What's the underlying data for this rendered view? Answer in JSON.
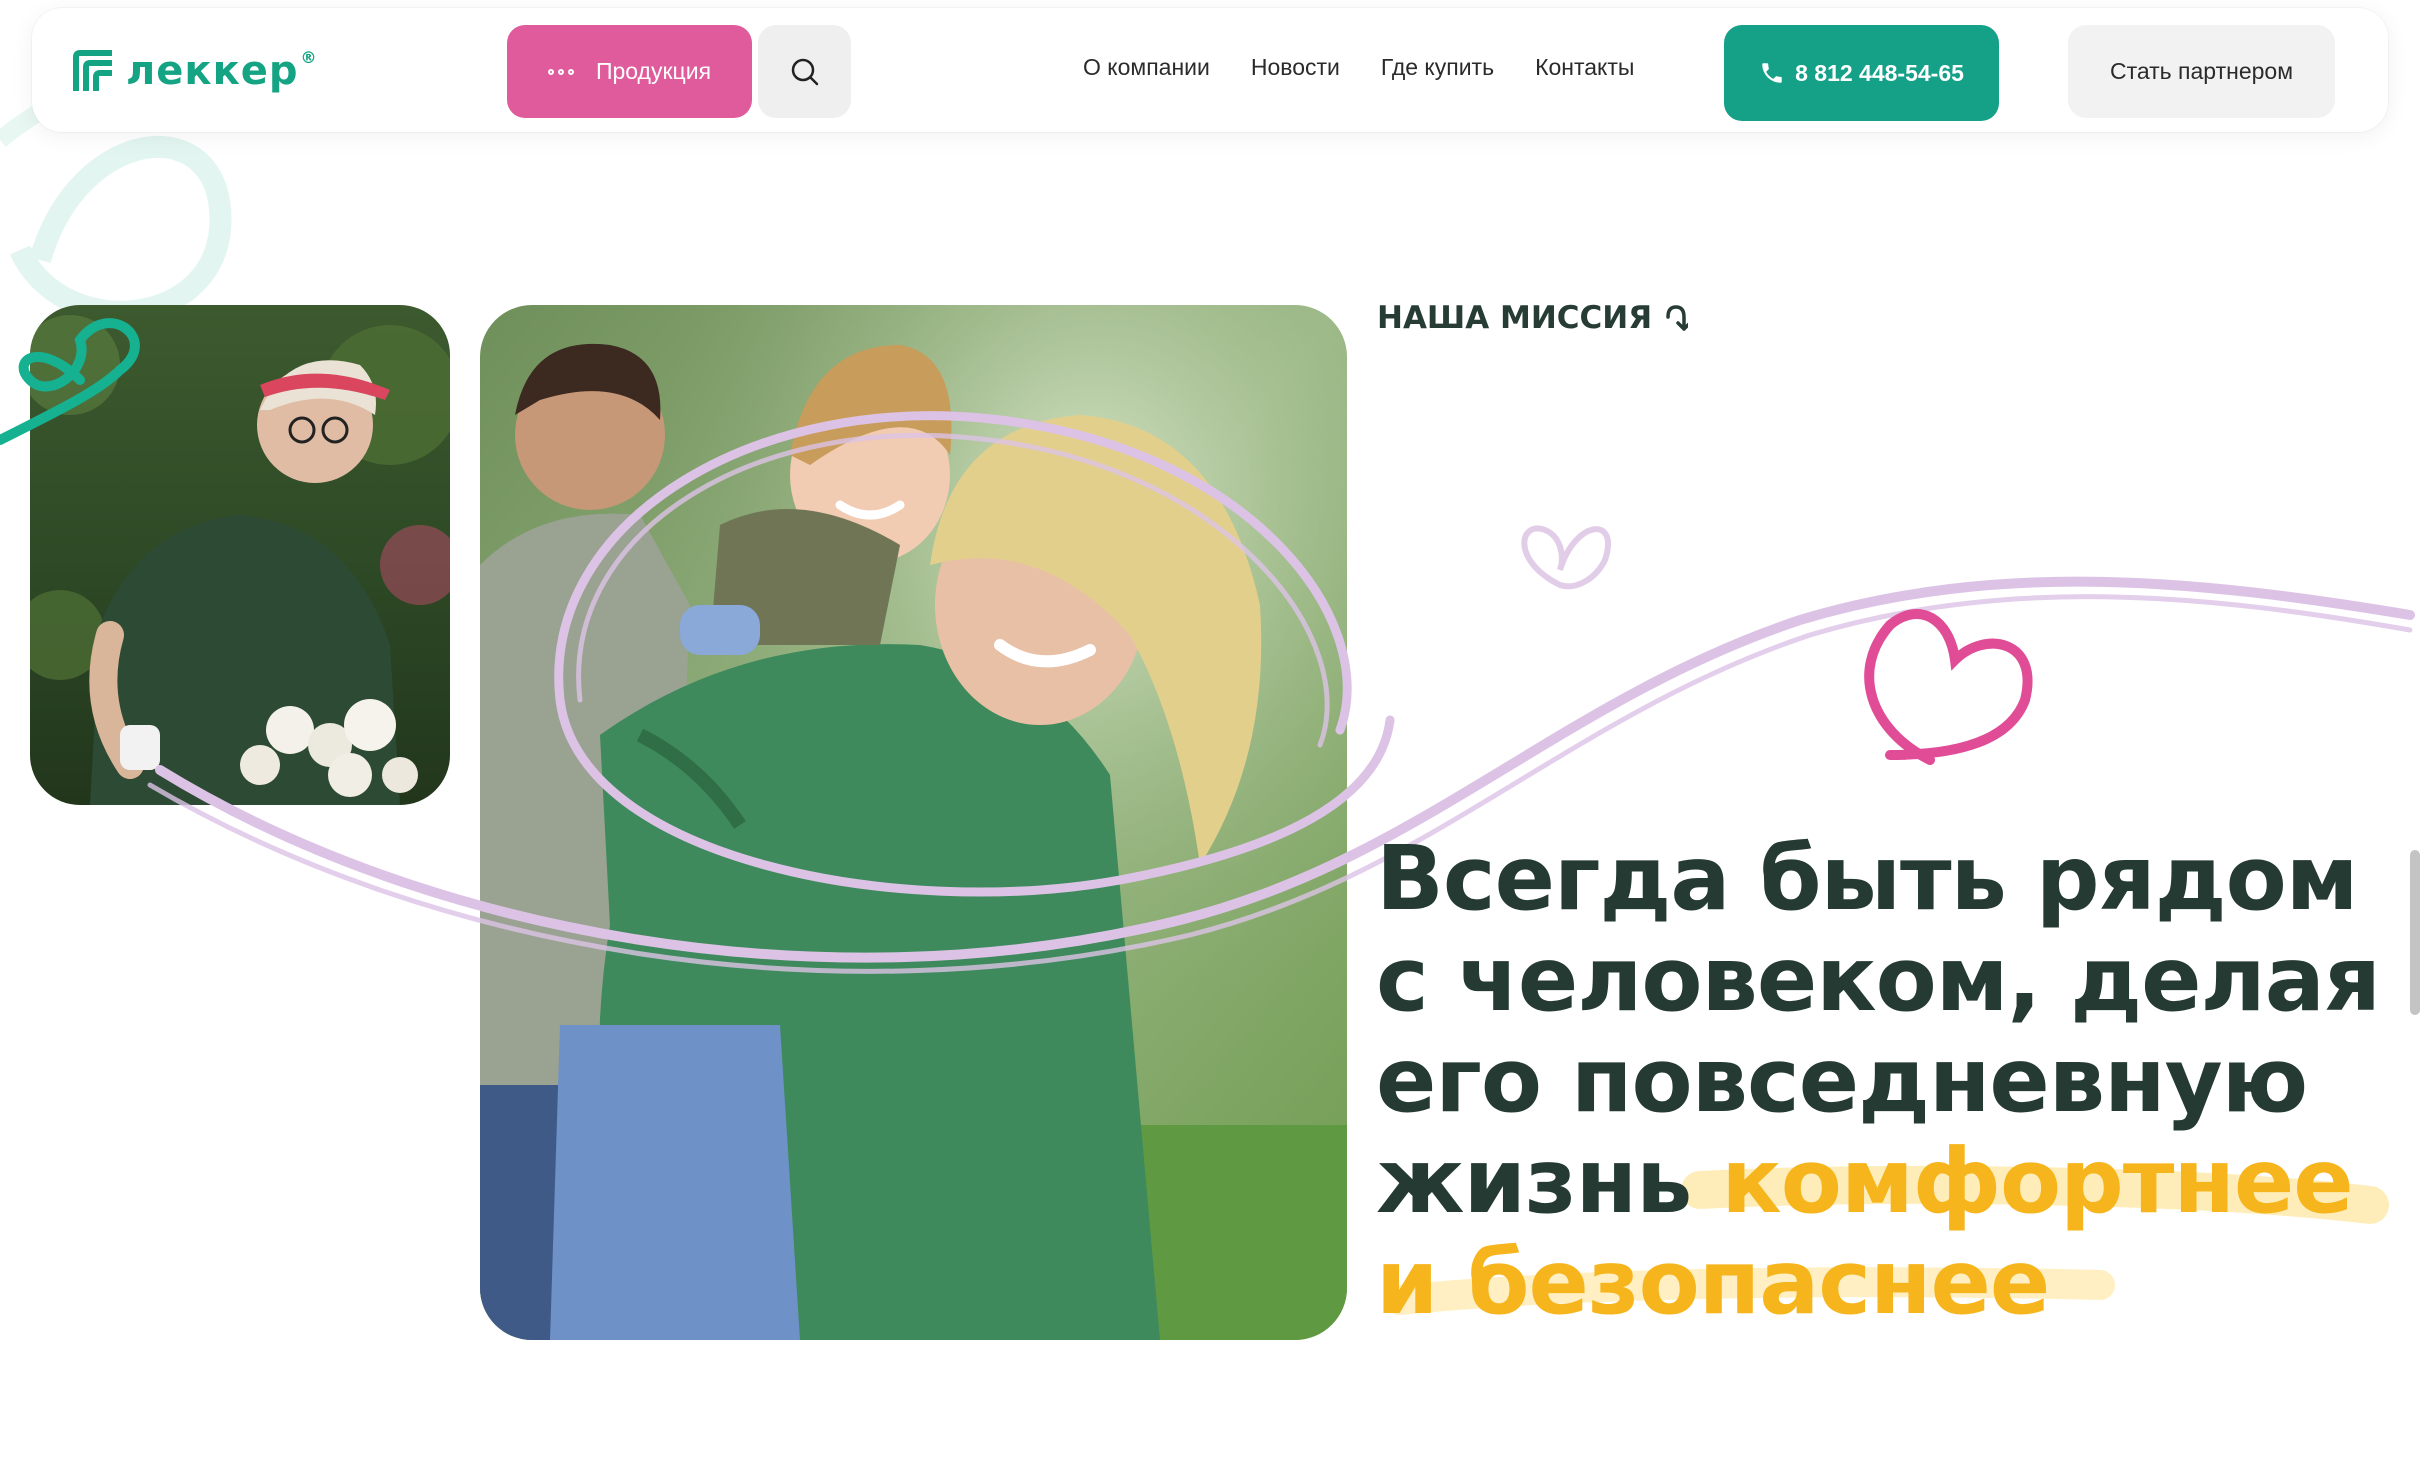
{
  "header": {
    "logo_text": "леккер",
    "logo_reg": "®",
    "products_label": "Продукция",
    "nav": [
      "О компании",
      "Новости",
      "Где купить",
      "Контакты"
    ],
    "phone": "8 812 448-54-65",
    "partner_label": "Стать партнером"
  },
  "section": {
    "kicker": "НАША МИССИЯ",
    "headline_lines": [
      "Всегда быть рядом",
      "с человеком, делая",
      "его повседневную",
      "жизнь "
    ],
    "headline_accent_1": "комфортнее",
    "headline_accent_2": "и безопаснее"
  },
  "colors": {
    "brand_green": "#15a088",
    "products_pink": "#e05b9c",
    "headline_dark": "#253a33",
    "accent_yellow": "#f6b51c",
    "swirl_lilac": "#dcc3e6"
  },
  "icons": [
    "logo-mark-icon",
    "dots-icon",
    "search-icon",
    "phone-icon",
    "arrow-down-icon",
    "heart-icon"
  ]
}
